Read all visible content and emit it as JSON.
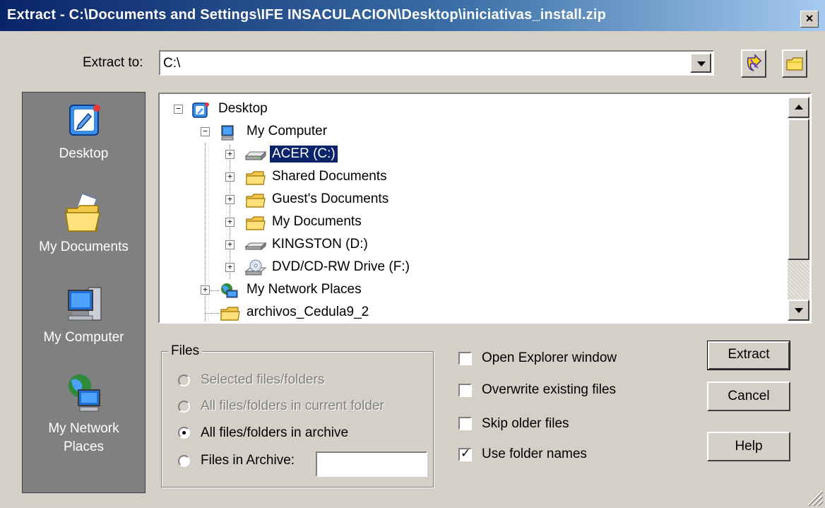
{
  "window": {
    "title": "Extract - C:\\Documents and Settings\\IFE INSACULACION\\Desktop\\iniciativas_install.zip",
    "close_label": "×"
  },
  "extract_to": {
    "label": "Extract to:",
    "value": "C:\\"
  },
  "places": [
    {
      "label": "Desktop",
      "icon": "desktop-icon"
    },
    {
      "label": "My Documents",
      "icon": "my-documents-icon"
    },
    {
      "label": "My Computer",
      "icon": "my-computer-icon"
    },
    {
      "label": "My Network\nPlaces",
      "icon": "network-places-icon"
    }
  ],
  "tree": {
    "desktop": "Desktop",
    "my_computer": "My Computer",
    "acer": "ACER (C:)",
    "shared_docs": "Shared Documents",
    "guest_docs": "Guest's Documents",
    "my_docs": "My Documents",
    "kingston": "KINGSTON (D:)",
    "dvd": "DVD/CD-RW Drive (F:)",
    "network": "My Network Places",
    "archivos": "archivos_Cedula9_2"
  },
  "files": {
    "label": "Files",
    "options": [
      {
        "label": "Selected files/folders",
        "enabled": false,
        "selected": false
      },
      {
        "label": "All files/folders in current folder",
        "enabled": false,
        "selected": false
      },
      {
        "label": "All files/folders in archive",
        "enabled": true,
        "selected": true
      },
      {
        "label": "Files in Archive:",
        "enabled": true,
        "selected": false
      }
    ],
    "archive_input_value": ""
  },
  "options": [
    {
      "label": "Open Explorer window",
      "checked": false
    },
    {
      "label": "Overwrite existing files",
      "checked": false
    },
    {
      "label": "Skip older files",
      "checked": false
    },
    {
      "label": "Use folder names",
      "checked": true
    }
  ],
  "buttons": {
    "extract": "Extract",
    "cancel": "Cancel",
    "help": "Help"
  },
  "colors": {
    "title_start": "#0a246a",
    "title_end": "#a6caf0",
    "face": "#d4d0c8",
    "selection": "#0a246a",
    "places_bg": "#808080"
  }
}
